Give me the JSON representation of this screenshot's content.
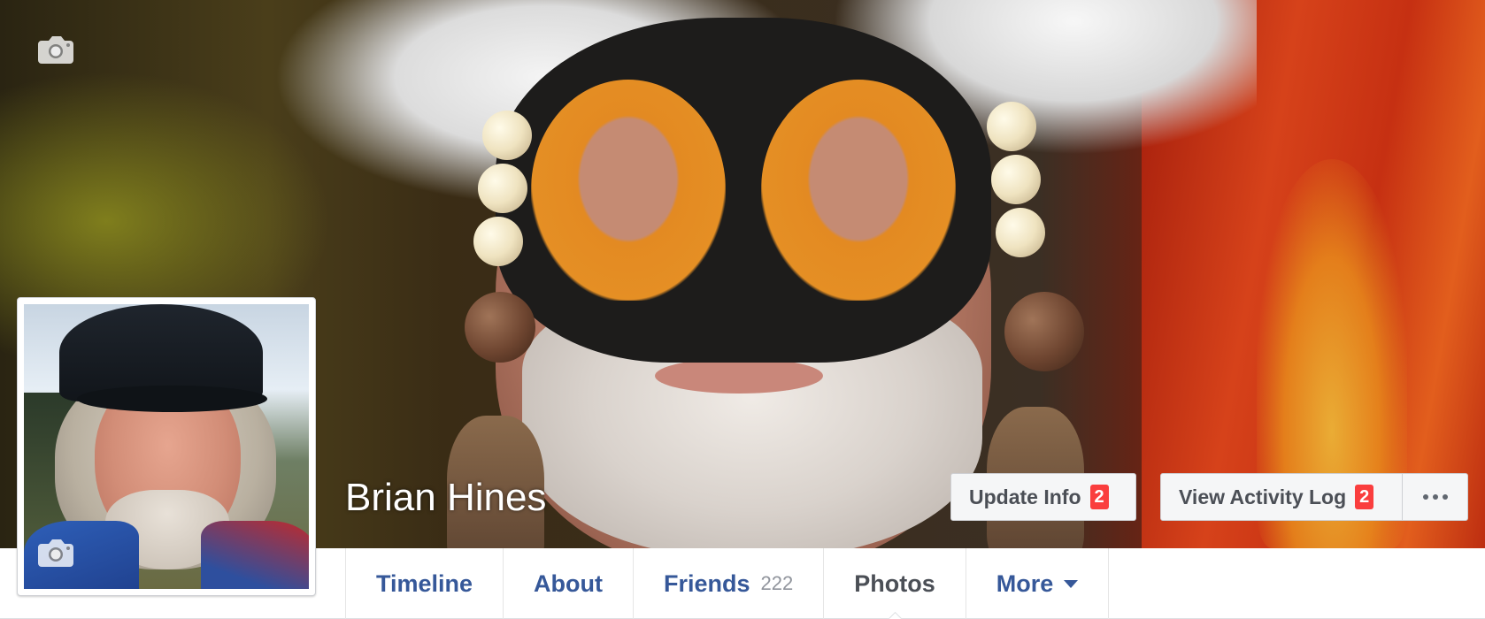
{
  "profile": {
    "name": "Brian Hines"
  },
  "cover": {
    "camera_icon": "camera-icon"
  },
  "profile_picture": {
    "camera_icon": "camera-icon"
  },
  "actions": {
    "update_info_label": "Update Info",
    "update_info_badge": "2",
    "activity_log_label": "View Activity Log",
    "activity_log_badge": "2",
    "more_icon": "ellipsis-icon"
  },
  "nav": {
    "tabs": [
      {
        "label": "Timeline"
      },
      {
        "label": "About"
      },
      {
        "label": "Friends",
        "count": "222"
      },
      {
        "label": "Photos",
        "active": true
      },
      {
        "label": "More",
        "icon": "caret-down-icon"
      }
    ]
  },
  "colors": {
    "link_blue": "#365899",
    "badge_red": "#fa3e3e",
    "button_bg": "#f5f6f7",
    "active_tab_text": "#4b4f56"
  }
}
